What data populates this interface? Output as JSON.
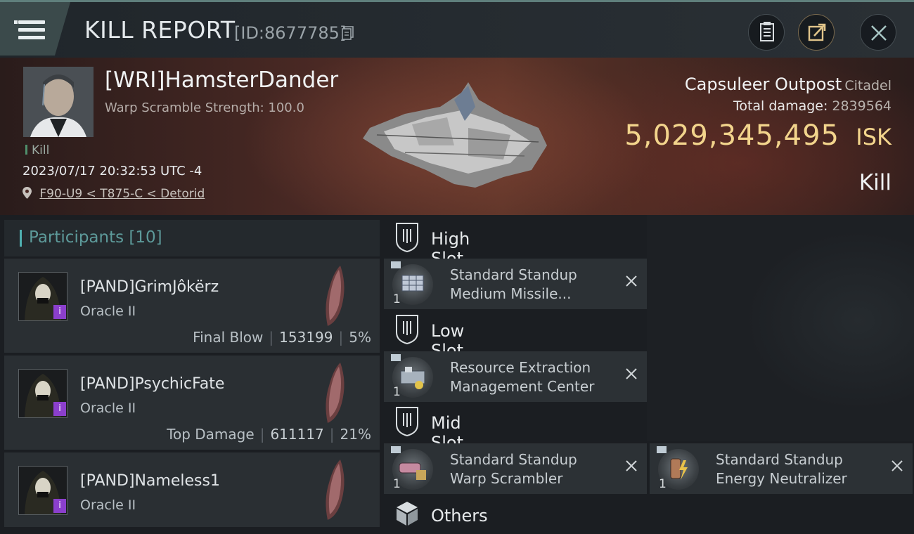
{
  "header": {
    "title": "KILL REPORT",
    "report_id": "[ID:8677785]",
    "buttons": [
      "clipboard-icon",
      "share-icon",
      "close-icon"
    ]
  },
  "victim": {
    "name": "[WRI]HamsterDander",
    "warp_scramble": "Warp Scramble Strength: 100.0",
    "event_type": "Kill",
    "datetime": "2023/07/17 20:32:53 UTC -4",
    "location": "F90-U9 < T875-C < Detorid",
    "ship_name": "Capsuleer Outpost",
    "ship_class": "Citadel",
    "total_damage_label": "Total damage:",
    "total_damage": "2839564",
    "isk_value": "5,029,345,495",
    "isk_unit": "ISK",
    "result": "Kill"
  },
  "participants": {
    "header": "Participants [10]",
    "rows": [
      {
        "name": "[PAND]GrimJôkërz",
        "ship": "Oracle II",
        "tag": "Final Blow",
        "damage": "153199",
        "percent": "5%"
      },
      {
        "name": "[PAND]PsychicFate",
        "ship": "Oracle II",
        "tag": "Top Damage",
        "damage": "611117",
        "percent": "21%"
      },
      {
        "name": "[PAND]Nameless1",
        "ship": "Oracle II",
        "tag": "",
        "damage": "",
        "percent": ""
      }
    ]
  },
  "fitting": {
    "high_slot": {
      "label": "High Slot",
      "modules": [
        {
          "qty": "1",
          "line1": "Standard Standup",
          "line2": "Medium Missile..."
        }
      ]
    },
    "low_slot": {
      "label": "Low Slot",
      "modules": [
        {
          "qty": "1",
          "line1": "Resource Extraction",
          "line2": "Management Center"
        }
      ]
    },
    "mid_slot": {
      "label": "Mid Slot",
      "modules": [
        {
          "qty": "1",
          "line1": "Standard Standup",
          "line2": "Warp Scrambler"
        },
        {
          "qty": "1",
          "line1": "Standard Standup",
          "line2": "Energy Neutralizer"
        }
      ]
    },
    "others": {
      "label": "Others"
    }
  },
  "colors": {
    "accent": "#4fb0b0",
    "isk": "#f2d48c",
    "badge": "#8b3fcc"
  }
}
